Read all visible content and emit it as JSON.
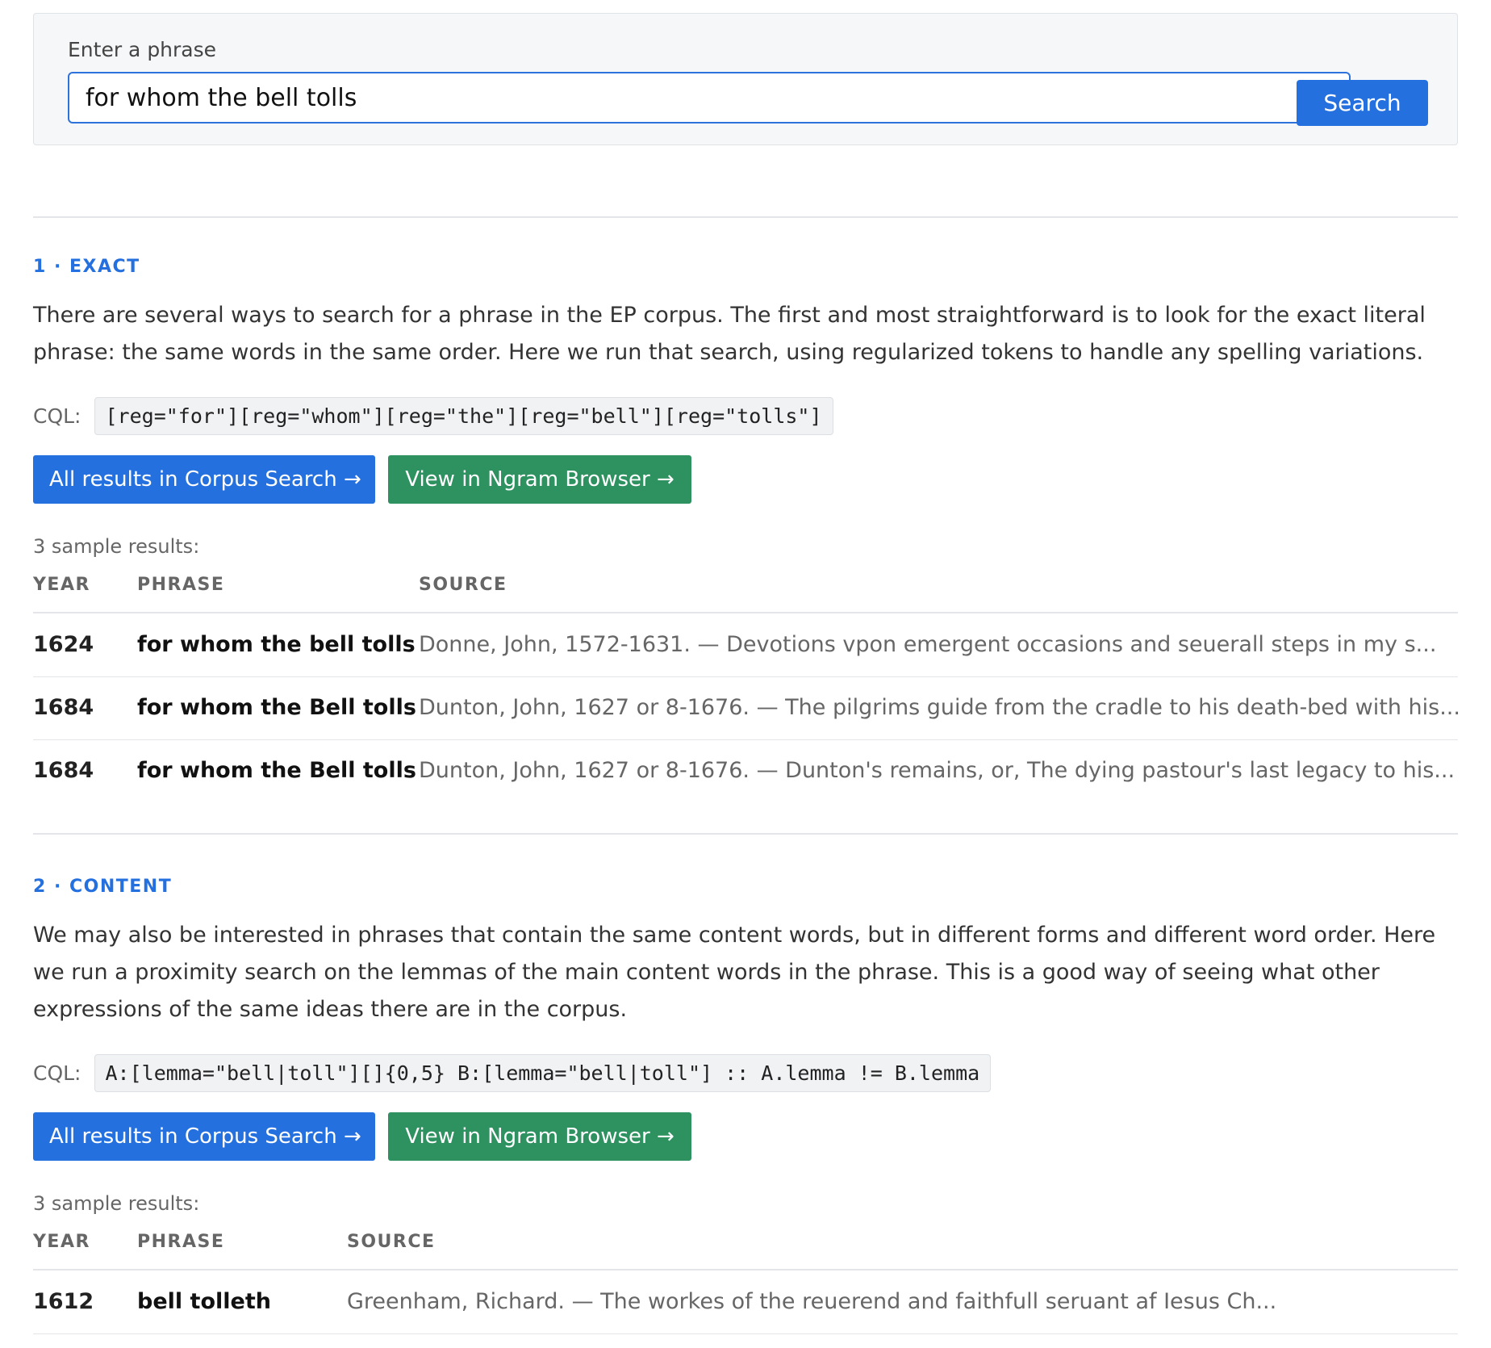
{
  "search": {
    "label": "Enter a phrase",
    "value": "for whom the bell tolls",
    "button": "Search"
  },
  "sections": [
    {
      "heading": "1 · EXACT",
      "description": "There are several ways to search for a phrase in the EP corpus. The first and most straightforward is to look for the exact literal phrase: the same words in the same order. Here we run that search, using regularized tokens to handle any spelling variations.",
      "cql_label": "CQL:",
      "cql": "[reg=\"for\"][reg=\"whom\"][reg=\"the\"][reg=\"bell\"][reg=\"tolls\"]",
      "corpus_button": "All results in Corpus Search →",
      "ngram_button": "View in Ngram Browser →",
      "sample_count": "3 sample results:",
      "columns": [
        "YEAR",
        "PHRASE",
        "SOURCE"
      ],
      "rows": [
        {
          "year": "1624",
          "phrase": "for whom the bell tolls",
          "source": "Donne, John, 1572-1631. — Devotions vpon emergent occasions and seuerall steps in my s..."
        },
        {
          "year": "1684",
          "phrase": "for whom the Bell tolls",
          "source": "Dunton, John, 1627 or 8-1676. — The pilgrims guide from the cradle to his death-bed with his..."
        },
        {
          "year": "1684",
          "phrase": "for whom the Bell tolls",
          "source": "Dunton, John, 1627 or 8-1676. — Dunton's remains, or, The dying pastour's last legacy to his..."
        }
      ]
    },
    {
      "heading": "2 · CONTENT",
      "description": "We may also be interested in phrases that contain the same content words, but in different forms and different word order. Here we run a proximity search on the lemmas of the main content words in the phrase. This is a good way of seeing what other expressions of the same ideas there are in the corpus.",
      "cql_label": "CQL:",
      "cql": "A:[lemma=\"bell|toll\"][]{0,5} B:[lemma=\"bell|toll\"] :: A.lemma != B.lemma",
      "corpus_button": "All results in Corpus Search →",
      "ngram_button": "View in Ngram Browser →",
      "sample_count": "3 sample results:",
      "columns": [
        "YEAR",
        "PHRASE",
        "SOURCE"
      ],
      "rows": [
        {
          "year": "1612",
          "phrase": "bell tolleth",
          "source": "Greenham, Richard. — The workes of the reuerend and faithfull seruant af Iesus Ch..."
        }
      ]
    }
  ],
  "colors": {
    "accent_blue": "#2570df",
    "accent_green": "#2e9160"
  }
}
